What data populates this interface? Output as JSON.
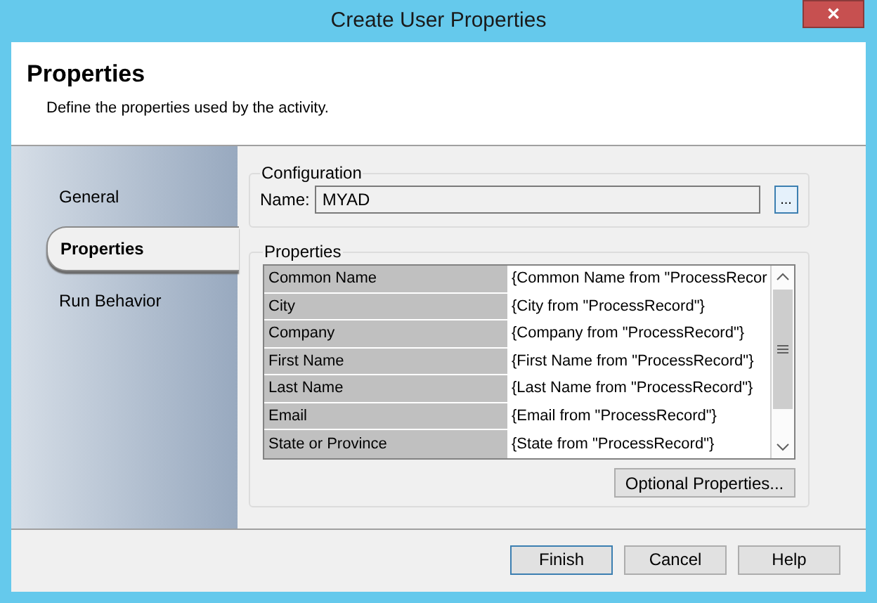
{
  "window": {
    "title": "Create User Properties",
    "close": "✕"
  },
  "header": {
    "title": "Properties",
    "subtitle": "Define the properties used by the activity."
  },
  "sidebar": {
    "items": [
      {
        "label": "General",
        "selected": false
      },
      {
        "label": "Properties",
        "selected": true
      },
      {
        "label": "Run Behavior",
        "selected": false
      }
    ]
  },
  "configuration": {
    "legend": "Configuration",
    "name_label": "Name:",
    "name_value": "MYAD",
    "browse": "..."
  },
  "properties": {
    "legend": "Properties",
    "rows": [
      {
        "name": "Common Name",
        "value": "{Common Name from \"ProcessRecor"
      },
      {
        "name": "City",
        "value": "{City from \"ProcessRecord\"}"
      },
      {
        "name": "Company",
        "value": "{Company from \"ProcessRecord\"}"
      },
      {
        "name": "First Name",
        "value": "{First Name from \"ProcessRecord\"}"
      },
      {
        "name": "Last Name",
        "value": "{Last Name from \"ProcessRecord\"}"
      },
      {
        "name": "Email",
        "value": "{Email from \"ProcessRecord\"}"
      },
      {
        "name": "State or Province",
        "value": "{State from \"ProcessRecord\"}"
      }
    ],
    "optional_button": "Optional Properties..."
  },
  "buttons": [
    {
      "label": "Finish",
      "default": true
    },
    {
      "label": "Cancel",
      "default": false
    },
    {
      "label": "Help",
      "default": false
    }
  ]
}
